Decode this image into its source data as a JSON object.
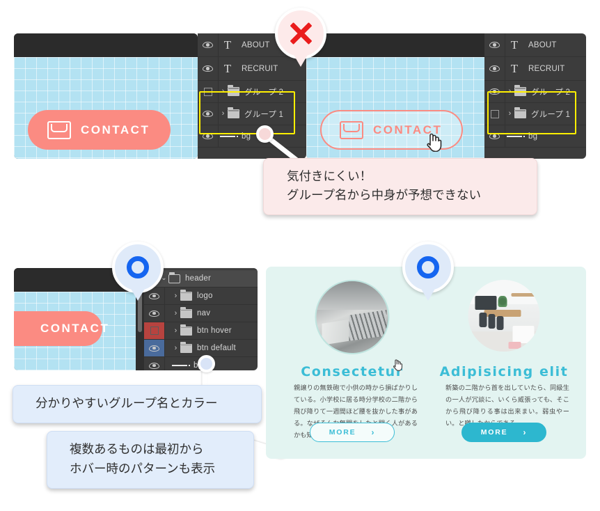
{
  "top_section": {
    "bad_example": {
      "contact_button_label": "CONTACT",
      "layers": [
        {
          "name": "ABOUT",
          "type": "text",
          "visible": true
        },
        {
          "name": "RECRUIT",
          "type": "text",
          "visible": true
        },
        {
          "name": "グループ 2",
          "type": "group",
          "visible": false,
          "highlighted": true
        },
        {
          "name": "グループ 1",
          "type": "group",
          "visible": true,
          "highlighted": true
        },
        {
          "name": "bg",
          "type": "shape",
          "visible": true
        }
      ]
    },
    "hover_example": {
      "contact_button_label": "CONTACT",
      "layers": [
        {
          "name": "ABOUT",
          "type": "text",
          "visible": true
        },
        {
          "name": "RECRUIT",
          "type": "text",
          "visible": true
        },
        {
          "name": "グループ 2",
          "type": "group",
          "visible": true,
          "highlighted": true
        },
        {
          "name": "グループ 1",
          "type": "group",
          "visible": false,
          "highlighted": true
        },
        {
          "name": "bg",
          "type": "shape",
          "visible": true
        }
      ]
    },
    "pin_icon": "x-mark-icon",
    "callout": {
      "text": "気付きにくい！\nグループ名から中身が予想できない",
      "style": "pink"
    }
  },
  "bottom_section": {
    "good_example": {
      "contact_button_label": "CONTACT",
      "layers": [
        {
          "name": "header",
          "type": "group-open",
          "visible": false
        },
        {
          "name": "logo",
          "type": "group",
          "visible": true,
          "rowcolor": ""
        },
        {
          "name": "nav",
          "type": "group",
          "visible": true,
          "rowcolor": ""
        },
        {
          "name": "btn hover",
          "type": "group",
          "visible": false,
          "rowcolor": "#b7433f"
        },
        {
          "name": "btn default",
          "type": "group",
          "visible": true,
          "rowcolor": "#4a6b9c"
        },
        {
          "name": "bg",
          "type": "shape",
          "visible": true,
          "rowcolor": ""
        }
      ]
    },
    "pin_icon_left": "circle-mark-icon",
    "pin_icon_right": "circle-mark-icon",
    "callout_group_name": {
      "text": "分かりやすいグループ名とカラー",
      "style": "blue"
    },
    "callout_hover_pattern": {
      "text": "複数あるものは最初から\nホバー時のパターンも表示",
      "style": "blue"
    }
  },
  "cards": [
    {
      "title": "Consectetur",
      "body": "親譲りの無鉄砲で小供の時から損ばかりしている。小学校に居る時分学校の二階から飛び降りて一週間ほど腰を抜かした事がある。なぜそんな無闇をしたと聞く人があるかも知れぬ。",
      "button_label": "MORE",
      "button_arrow": "›",
      "button_style": "ghost",
      "photo": "laptop-keyboard-photo"
    },
    {
      "title": "Adipisicing elit",
      "body": "新築の二階から首を出していたら、同級生の一人が冗談に、いくら威張っても、そこから飛び降りる事は出来まい。弱虫やーい。と囃したからである。",
      "button_label": "MORE",
      "button_arrow": "›",
      "button_style": "solid",
      "photo": "meeting-room-photo"
    }
  ],
  "colors": {
    "accent_pink": "#fb8b82",
    "accent_cyan": "#3bbdd6",
    "highlight_yellow": "#fff000",
    "panel_dark": "#3c3c3c",
    "mock_blue": "#b3e2f2",
    "card_bg": "#e3f4f1",
    "pin_red": "#ea1c1c",
    "pin_blue": "#1565f0",
    "row_red": "#b7433f",
    "row_blue": "#4a6b9c"
  }
}
